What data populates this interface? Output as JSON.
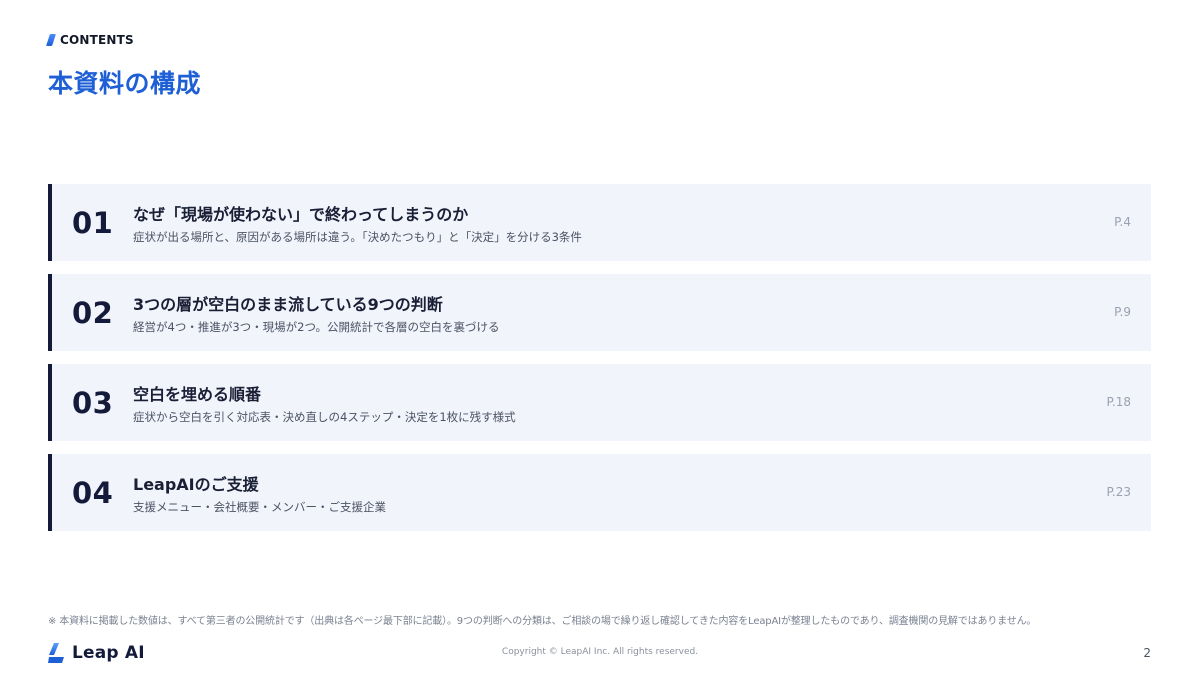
{
  "header": {
    "section_label": "CONTENTS",
    "title": "本資料の構成"
  },
  "toc": [
    {
      "number": "01",
      "title": "なぜ「現場が使わない」で終わってしまうのか",
      "subtitle": "症状が出る場所と、原因がある場所は違う。「決めたつもり」と「決定」を分ける3条件",
      "page": "P.4"
    },
    {
      "number": "02",
      "title": "3つの層が空白のまま流している9つの判断",
      "subtitle": "経営が4つ・推進が3つ・現場が2つ。公開統計で各層の空白を裏づける",
      "page": "P.9"
    },
    {
      "number": "03",
      "title": "空白を埋める順番",
      "subtitle": "症状から空白を引く対応表・決め直しの4ステップ・決定を1枚に残す様式",
      "page": "P.18"
    },
    {
      "number": "04",
      "title": "LeapAIのご支援",
      "subtitle": "支援メニュー・会社概要・メンバー・ご支援企業",
      "page": "P.23"
    }
  ],
  "footnote": "※ 本資料に掲載した数値は、すべて第三者の公開統計です（出典は各ページ最下部に記載）。9つの判断への分類は、ご相談の場で繰り返し確認してきた内容をLeapAIが整理したものであり、調査機関の見解ではありません。",
  "footer": {
    "logo_text": "Leap AI",
    "copyright": "Copyright © LeapAI Inc. All rights reserved.",
    "page_number": "2"
  },
  "colors": {
    "accent": "#1f5fd6",
    "navy": "#141a3a",
    "card_bg": "#f1f4fb"
  },
  "icons": {
    "section_tag": "slash-mark-icon",
    "logo": "leap-ai-logo-icon"
  }
}
